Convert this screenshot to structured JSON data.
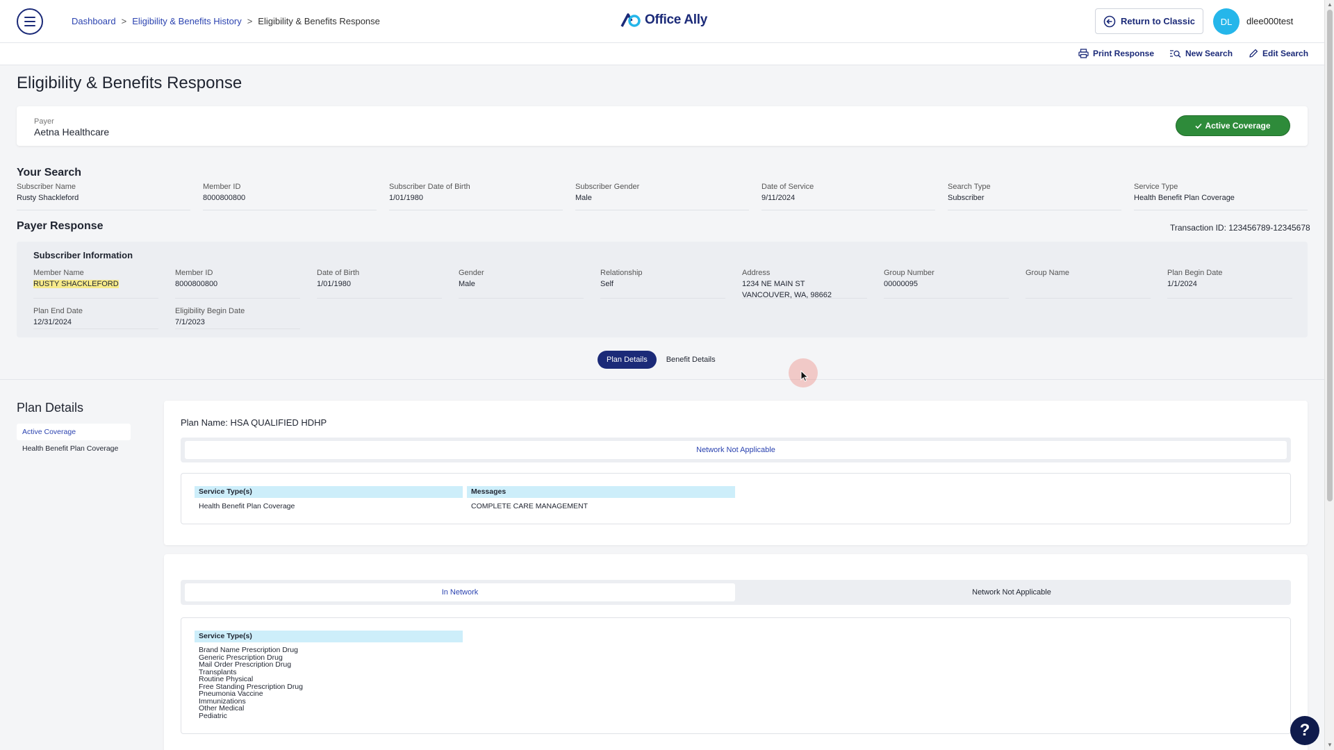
{
  "breadcrumb": [
    {
      "label": "Dashboard"
    },
    {
      "label": "Eligibility & Benefits History"
    },
    {
      "label": "Eligibility & Benefits Response"
    }
  ],
  "header": {
    "logo_text": "Office Ally",
    "return_label": "Return to Classic",
    "avatar_initials": "DL",
    "username": "dlee000test"
  },
  "actions": {
    "print": "Print Response",
    "new_search": "New Search",
    "edit_search": "Edit Search"
  },
  "page_title": "Eligibility & Benefits Response",
  "payer": {
    "label": "Payer",
    "name": "Aetna Healthcare",
    "coverage_label": "Active Coverage"
  },
  "search": {
    "heading": "Your Search",
    "fields": [
      {
        "label": "Subscriber Name",
        "value": "Rusty Shackleford"
      },
      {
        "label": "Member ID",
        "value": "8000800800"
      },
      {
        "label": "Subscriber Date of Birth",
        "value": "1/01/1980"
      },
      {
        "label": "Subscriber Gender",
        "value": "Male"
      },
      {
        "label": "Date of Service",
        "value": "9/11/2024"
      },
      {
        "label": "Search Type",
        "value": "Subscriber"
      },
      {
        "label": "Service Type",
        "value": "Health Benefit Plan Coverage"
      }
    ]
  },
  "response": {
    "heading": "Payer Response",
    "transaction": "Transaction ID: 123456789-12345678"
  },
  "subscriber": {
    "title": "Subscriber Information",
    "fields": [
      {
        "label": "Member Name",
        "value": "RUSTY SHACKLEFORD"
      },
      {
        "label": "Member ID",
        "value": "8000800800"
      },
      {
        "label": "Date of Birth",
        "value": "1/01/1980"
      },
      {
        "label": "Gender",
        "value": "Male"
      },
      {
        "label": "Relationship",
        "value": "Self"
      },
      {
        "label": "Address",
        "value": "1234 NE MAIN ST",
        "value2": "VANCOUVER, WA, 98662"
      },
      {
        "label": "Group Number",
        "value": "00000095"
      },
      {
        "label": "Group Name",
        "value": ""
      },
      {
        "label": "Plan Begin Date",
        "value": "1/1/2024"
      },
      {
        "label": "Plan End Date",
        "value": "12/31/2024"
      },
      {
        "label": "Eligibility Begin Date",
        "value": "7/1/2023"
      }
    ]
  },
  "view_toggle": {
    "plan": "Plan Details",
    "benefit": "Benefit Details"
  },
  "plan": {
    "heading": "Plan Details",
    "sidebar": [
      {
        "label": "Active Coverage"
      },
      {
        "label": "Health Benefit Plan Coverage"
      }
    ],
    "card1": {
      "plan_name": "Plan Name: HSA QUALIFIED HDHP",
      "tab": "Network Not Applicable",
      "col1_header": "Service Type(s)",
      "col2_header": "Messages",
      "col1_value": "Health Benefit Plan Coverage",
      "col2_value": "COMPLETE CARE MANAGEMENT"
    },
    "card2": {
      "tab_in": "In Network",
      "tab_na": "Network Not Applicable",
      "col_header": "Service Type(s)",
      "services": [
        "Brand Name Prescription Drug",
        "Generic Prescription Drug",
        "Mail Order Prescription Drug",
        "Transplants",
        "Routine Physical",
        "Free Standing Prescription Drug",
        "Pneumonia Vaccine",
        "Immunizations",
        "Other Medical",
        "Pediatric"
      ]
    }
  },
  "help": "?",
  "colors": {
    "brand": "#1b2a78",
    "link": "#2b43b0",
    "active": "#2e8b3a",
    "header_cell": "#cdeefa"
  }
}
